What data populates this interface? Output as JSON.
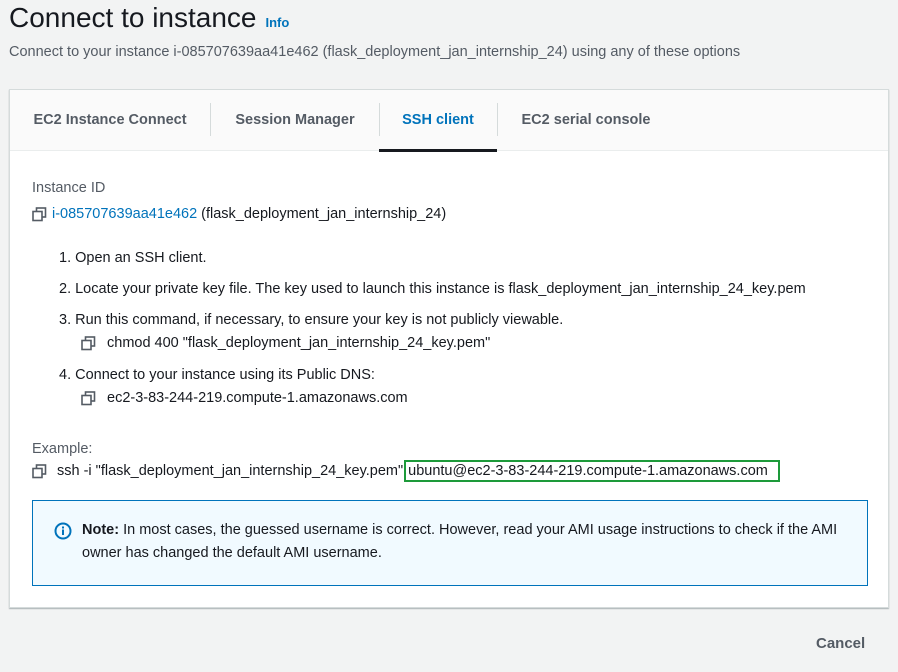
{
  "header": {
    "title": "Connect to instance",
    "info_label": "Info",
    "subtitle": "Connect to your instance i-085707639aa41e462 (flask_deployment_jan_internship_24) using any of these options"
  },
  "tabs": [
    {
      "label": "EC2 Instance Connect",
      "active": false
    },
    {
      "label": "Session Manager",
      "active": false
    },
    {
      "label": "SSH client",
      "active": true
    },
    {
      "label": "EC2 serial console",
      "active": false
    }
  ],
  "instance": {
    "label": "Instance ID",
    "id": "i-085707639aa41e462",
    "name": "(flask_deployment_jan_internship_24)"
  },
  "steps": [
    {
      "text": "1. Open an SSH client."
    },
    {
      "text": "2. Locate your private key file. The key used to launch this instance is flask_deployment_jan_internship_24_key.pem"
    },
    {
      "text": "3. Run this command, if necessary, to ensure your key is not publicly viewable.",
      "command": "chmod 400 \"flask_deployment_jan_internship_24_key.pem\""
    },
    {
      "text": "4. Connect to your instance using its Public DNS:",
      "command": "ec2-3-83-244-219.compute-1.amazonaws.com"
    }
  ],
  "example": {
    "label": "Example:",
    "command_prefix": "ssh -i \"flask_deployment_jan_internship_24_key.pem\"",
    "command_host": "ubuntu@ec2-3-83-244-219.compute-1.amazonaws.com"
  },
  "note": {
    "bold": "Note:",
    "text": " In most cases, the guessed username is correct. However, read your AMI usage instructions to check if the AMI owner has changed the default AMI username."
  },
  "footer": {
    "cancel_label": "Cancel"
  },
  "colors": {
    "link": "#0073bb",
    "highlight_box": "#1d9a3a",
    "note_border": "#0073bb",
    "note_background": "#f1faff"
  },
  "icons": [
    "copy-icon",
    "info-circle-icon"
  ]
}
